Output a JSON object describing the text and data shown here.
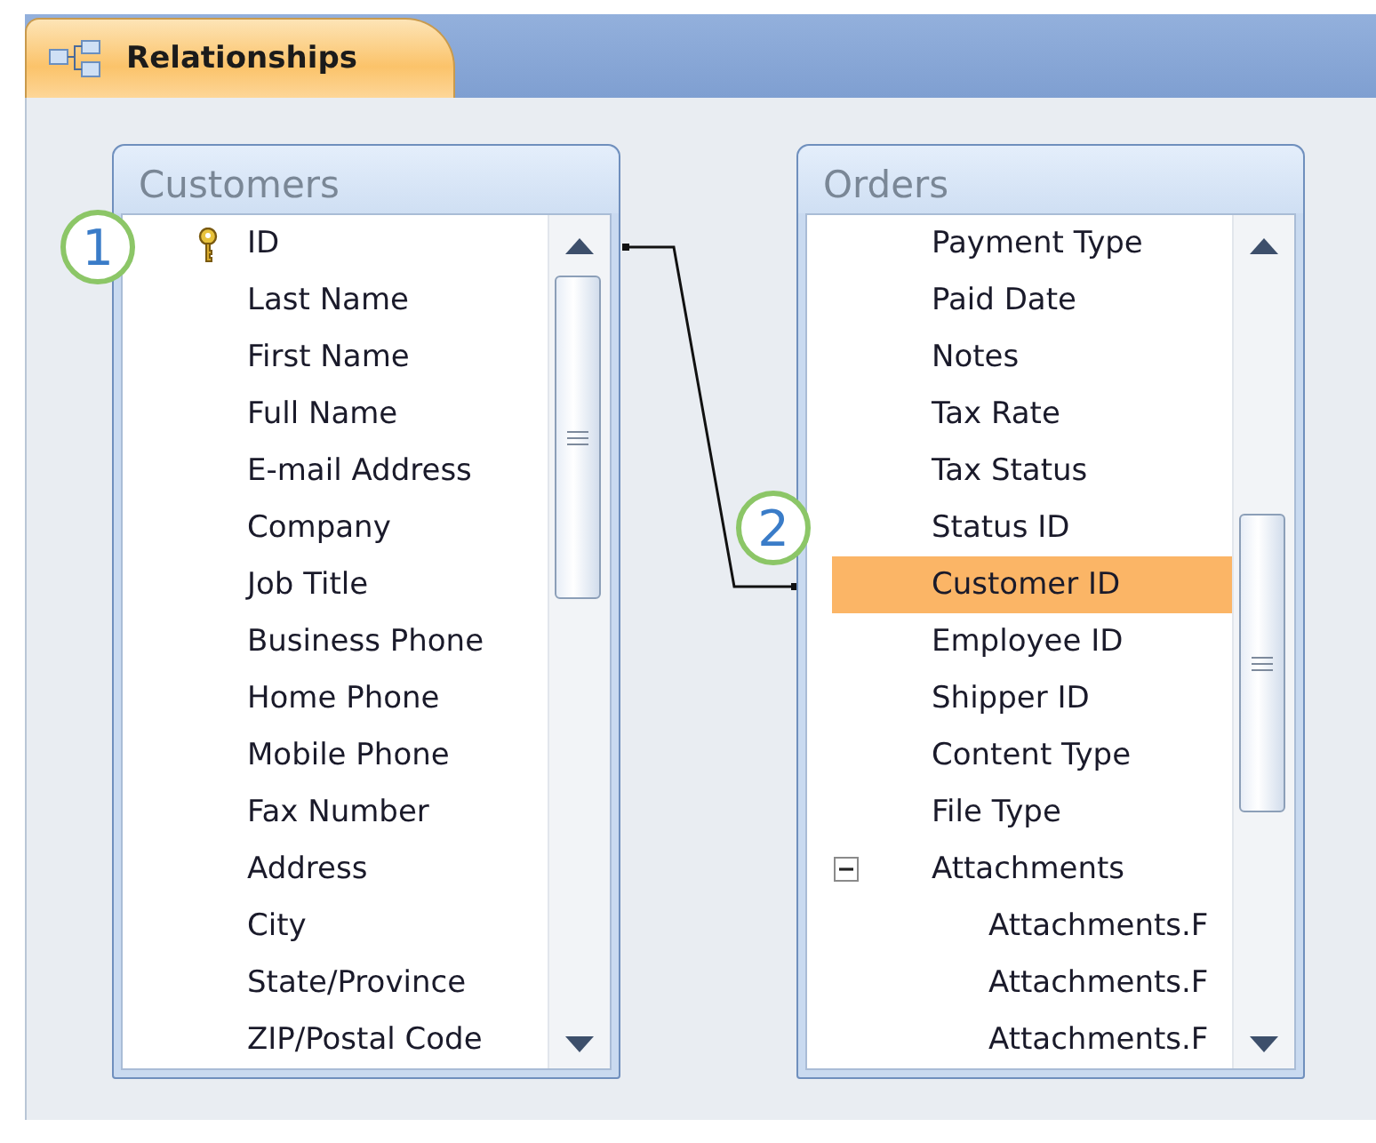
{
  "tab": {
    "label": "Relationships",
    "selected": true
  },
  "tables": [
    {
      "title": "Customers",
      "badge": "1",
      "fields": [
        {
          "name": "ID",
          "primary_key": true,
          "selected": false
        },
        {
          "name": "Last Name",
          "primary_key": false,
          "selected": false
        },
        {
          "name": "First Name",
          "primary_key": false,
          "selected": false
        },
        {
          "name": "Full Name",
          "primary_key": false,
          "selected": false
        },
        {
          "name": "E-mail Address",
          "primary_key": false,
          "selected": false
        },
        {
          "name": "Company",
          "primary_key": false,
          "selected": false
        },
        {
          "name": "Job Title",
          "primary_key": false,
          "selected": false
        },
        {
          "name": "Business Phone",
          "primary_key": false,
          "selected": false
        },
        {
          "name": "Home Phone",
          "primary_key": false,
          "selected": false
        },
        {
          "name": "Mobile Phone",
          "primary_key": false,
          "selected": false
        },
        {
          "name": "Fax Number",
          "primary_key": false,
          "selected": false
        },
        {
          "name": "Address",
          "primary_key": false,
          "selected": false
        },
        {
          "name": "City",
          "primary_key": false,
          "selected": false
        },
        {
          "name": "State/Province",
          "primary_key": false,
          "selected": false
        },
        {
          "name": "ZIP/Postal Code",
          "primary_key": false,
          "selected": false
        }
      ]
    },
    {
      "title": "Orders",
      "badge": "2",
      "fields": [
        {
          "name": "Payment Type",
          "primary_key": false,
          "selected": false
        },
        {
          "name": "Paid Date",
          "primary_key": false,
          "selected": false
        },
        {
          "name": "Notes",
          "primary_key": false,
          "selected": false
        },
        {
          "name": "Tax Rate",
          "primary_key": false,
          "selected": false
        },
        {
          "name": "Tax Status",
          "primary_key": false,
          "selected": false
        },
        {
          "name": "Status ID",
          "primary_key": false,
          "selected": false
        },
        {
          "name": "Customer ID",
          "primary_key": false,
          "selected": true
        },
        {
          "name": "Employee ID",
          "primary_key": false,
          "selected": false
        },
        {
          "name": "Shipper ID",
          "primary_key": false,
          "selected": false
        },
        {
          "name": "Content Type",
          "primary_key": false,
          "selected": false
        },
        {
          "name": "File Type",
          "primary_key": false,
          "selected": false
        },
        {
          "name": "Attachments",
          "primary_key": false,
          "selected": false,
          "expanded": true,
          "children": [
            {
              "name": "Attachments.F",
              "primary_key": false,
              "selected": false
            },
            {
              "name": "Attachments.F",
              "primary_key": false,
              "selected": false
            },
            {
              "name": "Attachments.F",
              "primary_key": false,
              "selected": false
            }
          ]
        }
      ]
    }
  ]
}
